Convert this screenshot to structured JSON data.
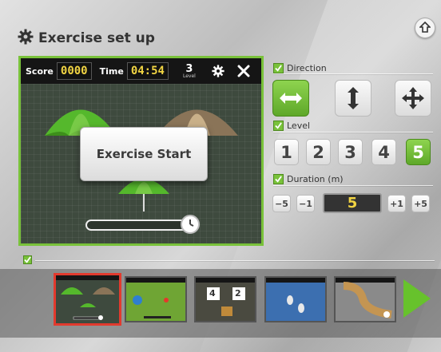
{
  "header": {
    "title": "Exercise set up"
  },
  "preview": {
    "score_label": "Score",
    "score_value": "0000",
    "time_label": "Time",
    "time_value": "04:54",
    "level_value": "3",
    "level_caption": "Level",
    "start_label": "Exercise Start"
  },
  "settings": {
    "direction_label": "Direction",
    "level_label": "Level",
    "levels": [
      "1",
      "2",
      "3",
      "4",
      "5"
    ],
    "selected_level": "5",
    "duration_label": "Duration (m)",
    "duration_minus5": "−5",
    "duration_minus1": "−1",
    "duration_value": "5",
    "duration_plus1": "+1",
    "duration_plus5": "+5"
  },
  "thumbnails": {
    "count": 5,
    "selected_index": 0,
    "game3_values": [
      "4",
      "2"
    ]
  },
  "colors": {
    "accent": "#67c22c",
    "selected_border": "#e23a2e",
    "lcd_text": "#f1d443"
  },
  "icons": [
    "gear-icon",
    "home-icon",
    "close-icon",
    "horizontal-arrows-icon",
    "vertical-arrows-icon",
    "four-way-arrows-icon",
    "check-icon",
    "stopwatch-icon",
    "next-arrow-icon"
  ]
}
